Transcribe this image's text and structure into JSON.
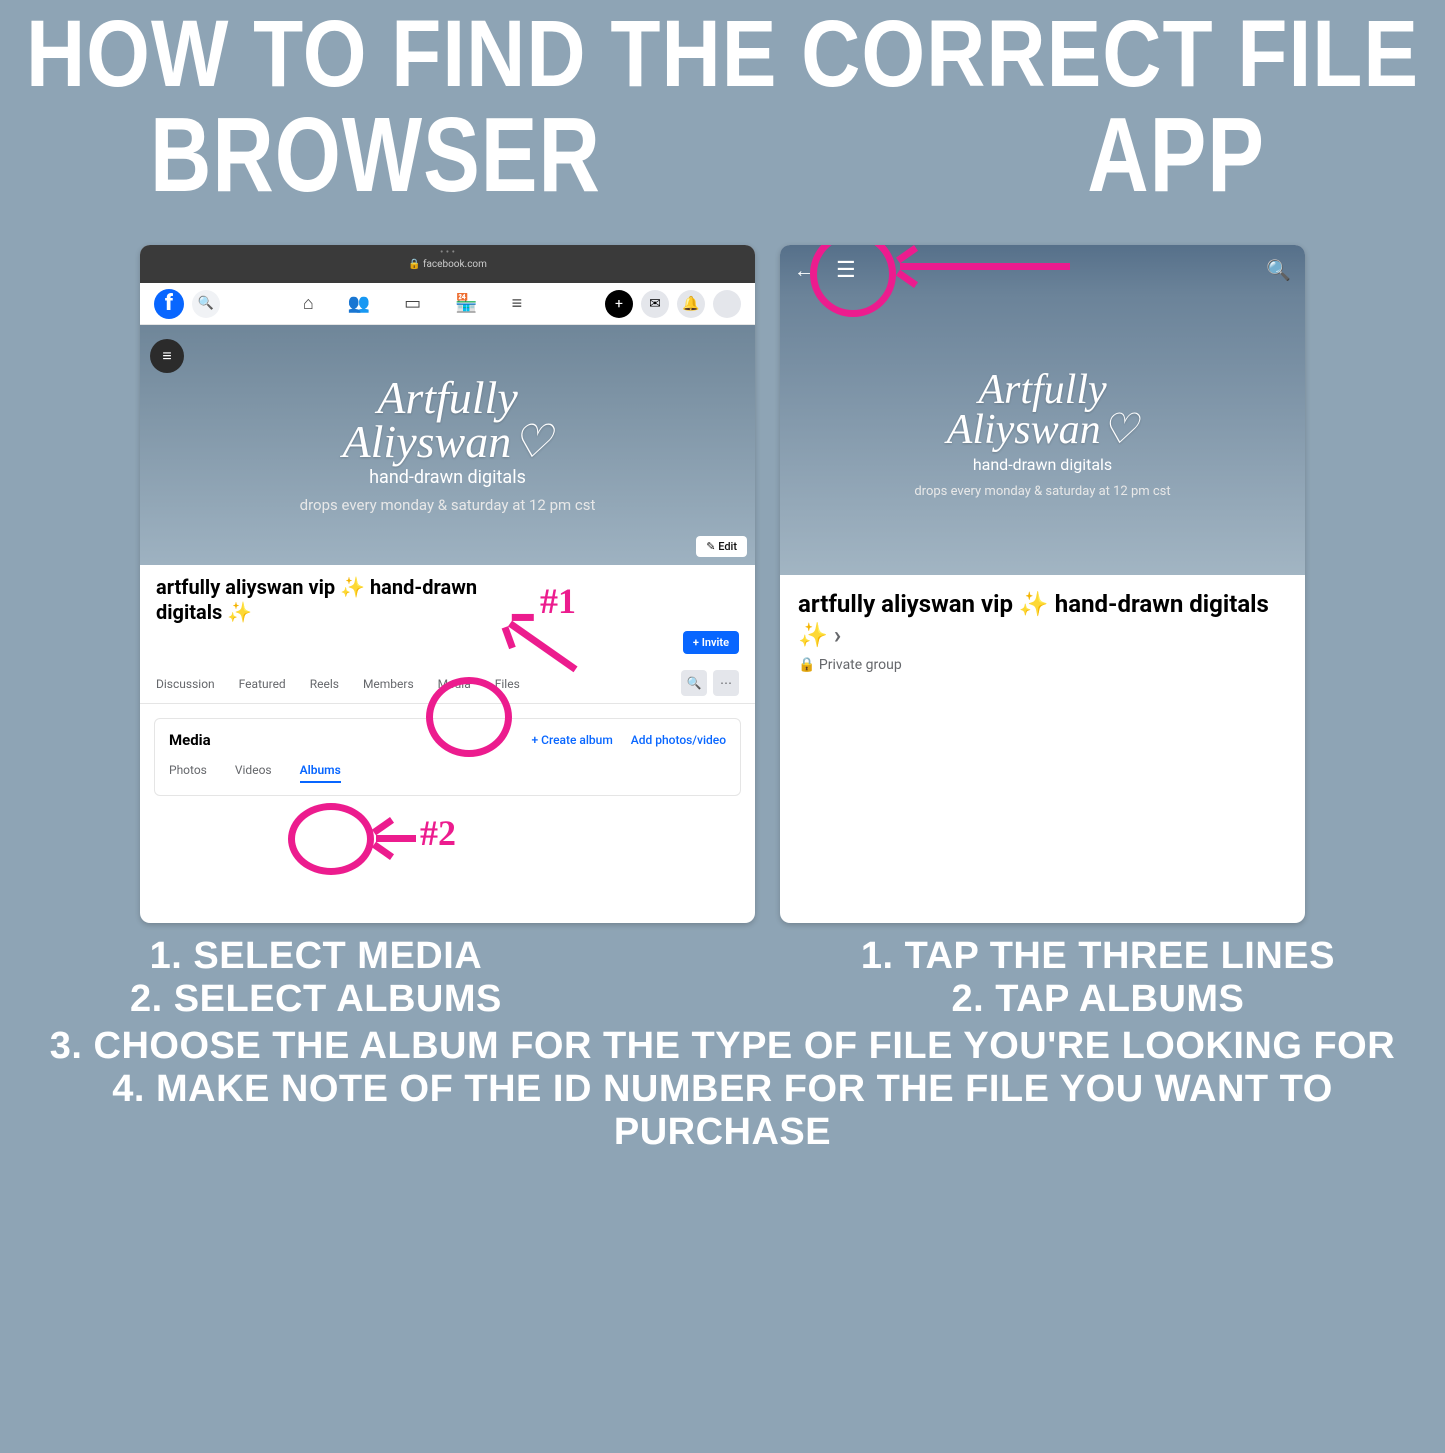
{
  "main_title": "HOW TO FIND THE CORRECT FILE",
  "columns": {
    "browser": "BROWSER",
    "app": "APP"
  },
  "browser": {
    "url": "facebook.com",
    "brand_line1": "Artfully",
    "brand_line2": "Aliyswan♡",
    "tag1": "hand-drawn digitals",
    "tag2": "drops every monday & saturday at 12 pm cst",
    "edit": "✎ Edit",
    "group_title": "artfully aliyswan vip ✨ hand-drawn digitals ✨",
    "invite": "+ Invite",
    "tabs": [
      "Discussion",
      "Featured",
      "Reels",
      "Members",
      "Media",
      "Files"
    ],
    "media_section": "Media",
    "media_links": {
      "create": "+  Create album",
      "add": "Add photos/video"
    },
    "media_tabs": [
      "Photos",
      "Videos",
      "Albums"
    ]
  },
  "app": {
    "brand_line1": "Artfully",
    "brand_line2": "Aliyswan♡",
    "tag1": "hand-drawn digitals",
    "tag2": "drops every monday & saturday at 12 pm cst",
    "group_title": "artfully aliyswan vip ✨ hand-drawn digitals ✨",
    "private": "🔒 Private group"
  },
  "annotations": {
    "label1": "#1",
    "label2": "#2"
  },
  "instr": {
    "b1": "1. SELECT MEDIA",
    "b2": "2. SELECT ALBUMS",
    "a1": "1. TAP THE THREE LINES",
    "a2": "2. TAP ALBUMS",
    "l3": "3. CHOOSE THE ALBUM FOR THE TYPE OF FILE YOU'RE LOOKING FOR",
    "l4": "4. MAKE NOTE OF THE ID NUMBER FOR THE FILE YOU WANT TO PURCHASE"
  }
}
